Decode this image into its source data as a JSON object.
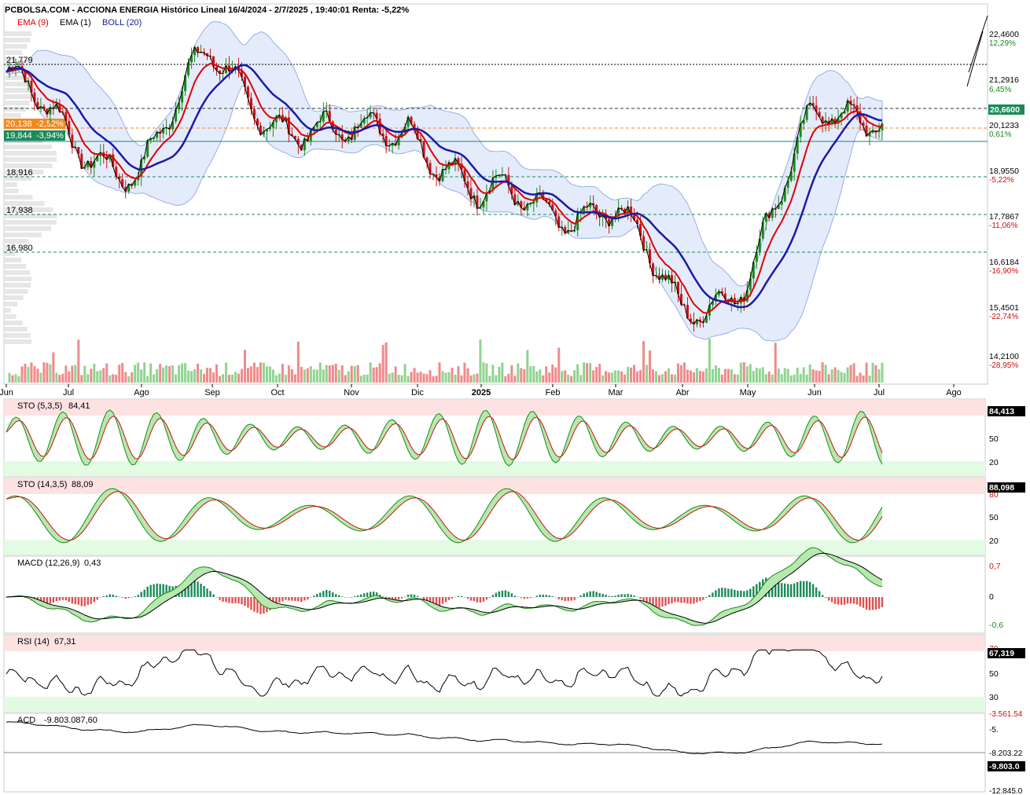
{
  "header": {
    "title": "PCBOLSA.COM - ACCIONA ENERGIA Histórico Lineal 16/4/2024 - 2/7/2025 , 19:40:01 Renta: -5,22%"
  },
  "legend": [
    {
      "label": "EMA (9)",
      "color": "#e00000"
    },
    {
      "label": "EMA (1)",
      "color": "#000000"
    },
    {
      "label": "BOLL (20)",
      "color": "#1a1aa8"
    }
  ],
  "colors": {
    "up": "#1a8a1a",
    "down": "#d01010",
    "vol_up": "#8fd48f",
    "vol_down": "#f08a8a",
    "band_fill": "#e4ecfb",
    "band_line": "#9aaee6",
    "ema9": "#e00000",
    "boll_mid": "#1a1aa8"
  },
  "price_scale": {
    "ticks": [
      {
        "value": "22,4600",
        "pct": "12,29%",
        "pct_color": "#1a8a1a"
      },
      {
        "value": "21,2916",
        "pct": "6,45%",
        "pct_color": "#1a8a1a"
      },
      {
        "value": "20,1233",
        "pct": "0,61%",
        "pct_color": "#1a8a1a"
      },
      {
        "value": "18,9550",
        "pct": "-5,22%",
        "pct_color": "#d01010"
      },
      {
        "value": "17,7867",
        "pct": "-11,06%",
        "pct_color": "#d01010"
      },
      {
        "value": "16,6184",
        "pct": "-16,90%",
        "pct_color": "#d01010"
      },
      {
        "value": "15,4501",
        "pct": "-22,74%",
        "pct_color": "#d01010"
      },
      {
        "value": "14,2100",
        "pct": "-28,95%",
        "pct_color": "#d01010"
      }
    ],
    "last_price_tag": "20,6600"
  },
  "levels": [
    {
      "label": "21,779"
    },
    {
      "label": "18,916"
    },
    {
      "label": "17,938"
    },
    {
      "label": "16,980"
    }
  ],
  "tags": [
    {
      "label": "20,138",
      "pct": "-2,52%"
    },
    {
      "label": "19,844",
      "pct": "-3,94%"
    }
  ],
  "x_axis": [
    "Jun",
    "Jul",
    "Ago",
    "Sep",
    "Oct",
    "Nov",
    "Dic",
    "2025",
    "Feb",
    "Mar",
    "Abr",
    "May",
    "Jun",
    "Jul",
    "Ago"
  ],
  "panels": {
    "sto1": {
      "label": "STO (5,3,5)",
      "value": "84,41",
      "tag": "84,413",
      "levels": [
        "50",
        "20"
      ]
    },
    "sto2": {
      "label": "STO (14,3,5)",
      "value": "88,09",
      "tag": "88,098",
      "levels": [
        "80",
        "50",
        "20"
      ]
    },
    "macd": {
      "label": "MACD (12,26,9)",
      "value": "0,43",
      "levels": [
        "0,7",
        "0",
        "-0,6"
      ]
    },
    "rsi": {
      "label": "RSI (14)",
      "value": "67,31",
      "tag": "67,319",
      "levels": [
        "70",
        "50",
        "30"
      ]
    },
    "acd": {
      "label": "ACD",
      "value": "-9.803.087,60",
      "tag": "-9.803.0",
      "levels": [
        "-3.561.54",
        "-5.",
        "-8.203.22",
        "-12.845.0"
      ]
    }
  },
  "chart_data": {
    "type": "line",
    "title": "ACCIONA ENERGIA Histórico Lineal 16/4/2024 - 2/7/2025",
    "ylim": [
      14.21,
      22.46
    ],
    "x": [
      "2024-06",
      "2024-07",
      "2024-08",
      "2024-09",
      "2024-10",
      "2024-11",
      "2024-12",
      "2025-01",
      "2025-02",
      "2025-03",
      "2025-04",
      "2025-05",
      "2025-06",
      "2025-07"
    ],
    "series": [
      {
        "name": "EMA (1)",
        "values": [
          21.5,
          19.5,
          19.2,
          21.8,
          20.4,
          19.6,
          20.3,
          18.2,
          18.0,
          18.1,
          15.2,
          16.4,
          20.2,
          20.66
        ]
      },
      {
        "name": "EMA (9)",
        "values": [
          21.2,
          19.8,
          19.4,
          21.1,
          20.5,
          19.8,
          20.0,
          18.4,
          18.0,
          18.0,
          15.6,
          16.3,
          19.8,
          20.1
        ]
      },
      {
        "name": "BOLL (20)",
        "values": [
          21.4,
          20.5,
          19.3,
          20.5,
          21.0,
          19.9,
          19.8,
          18.8,
          18.1,
          18.0,
          16.5,
          15.9,
          18.2,
          19.84
        ]
      }
    ]
  }
}
